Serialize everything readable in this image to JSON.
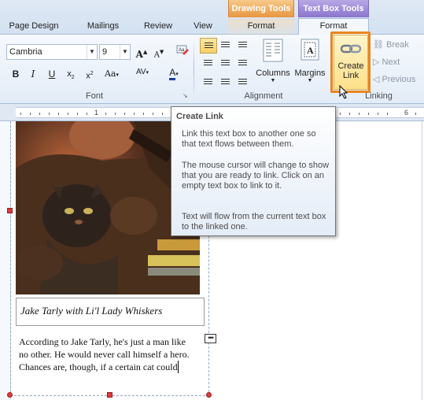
{
  "tabs": [
    {
      "label": "Page Design"
    },
    {
      "label": "Mailings"
    },
    {
      "label": "Review"
    },
    {
      "label": "View"
    },
    {
      "label": "Format"
    },
    {
      "label": "Format"
    }
  ],
  "contextual": {
    "drawing_tools": "Drawing Tools",
    "text_box_tools": "Text Box Tools"
  },
  "font_group": {
    "font_name": "Cambria",
    "font_size": "9",
    "label": "Font"
  },
  "alignment_group": {
    "columns_label": "Columns",
    "margins_label": "Margins",
    "label": "Alignment"
  },
  "linking_group": {
    "create_link_line1": "Create",
    "create_link_line2": "Link",
    "break_label": "Break",
    "next_label": "Next",
    "previous_label": "Previous",
    "label": "Linking"
  },
  "ruler": {
    "numbers": [
      "1",
      "6"
    ]
  },
  "tooltip": {
    "title": "Create Link",
    "p1": "Link this text box to another one so that text flows between them.",
    "p2": "The mouse cursor will change to show that you are ready to link. Click on an empty text box to link to it.",
    "p3": "Text will flow from the current text box to the linked one."
  },
  "document": {
    "caption": "Jake Tarly with Li'l Lady Whiskers",
    "body_lines": [
      "According to Jake Tarly, he's just a man like",
      "no other. He would never call himself a hero.",
      "Chances are, though, if a certain cat could"
    ]
  },
  "colors": {
    "drawing_tools": "#e8963f",
    "text_box_tools": "#8a74cd",
    "highlight": "#e8861e",
    "selection_handle": "#e23a3a"
  }
}
